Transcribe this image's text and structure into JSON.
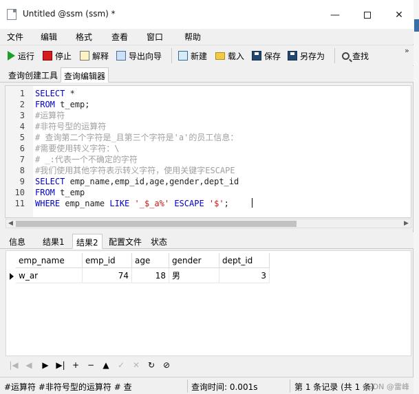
{
  "window": {
    "title": "Untitled @ssm (ssm) *",
    "controls": {
      "minimize": "—",
      "close": "✕"
    }
  },
  "menu": [
    "文件",
    "编辑",
    "格式",
    "查看",
    "窗口",
    "帮助"
  ],
  "toolbar": {
    "run": "运行",
    "stop": "停止",
    "explain": "解释",
    "export_wizard": "导出向导",
    "new": "新建",
    "load": "载入",
    "save": "保存",
    "save_as": "另存为",
    "find": "查找",
    "overflow": "»"
  },
  "editor_tabs": [
    "查询创建工具",
    "查询编辑器"
  ],
  "active_editor_tab": "查询编辑器",
  "editor": {
    "lines": [
      {
        "num": "1",
        "text": "SELECT *",
        "kind": "kw"
      },
      {
        "num": "2",
        "text": "FROM t_emp;",
        "kind": "kw"
      },
      {
        "num": "3",
        "text": "#运算符",
        "kind": "cm"
      },
      {
        "num": "4",
        "text": "#非符号型的运算符",
        "kind": "cm"
      },
      {
        "num": "5",
        "text": "# 查询第二个字符是_且第三个字符是'a'的员工信息：",
        "kind": "cm"
      },
      {
        "num": "6",
        "text": "#需要使用转义字符：\\",
        "kind": "cm"
      },
      {
        "num": "7",
        "text": "# _:代表一个不确定的字符",
        "kind": "cm"
      },
      {
        "num": "8",
        "text": "#我们使用其他字符表示转义字符，使用关键字ESCAPE",
        "kind": "cm"
      },
      {
        "num": "9",
        "text": "SELECT emp_name,emp_id,age,gender,dept_id",
        "kind": "kw"
      },
      {
        "num": "10",
        "text": "FROM t_emp",
        "kind": "kw"
      },
      {
        "num": "11",
        "text": "WHERE emp_name LIKE '_$_a%' ESCAPE '$';",
        "kind": "kw"
      }
    ]
  },
  "result_tabs": [
    "信息",
    "结果1",
    "结果2",
    "配置文件",
    "状态"
  ],
  "active_result_tab": "结果2",
  "grid": {
    "columns": [
      "emp_name",
      "emp_id",
      "age",
      "gender",
      "dept_id"
    ],
    "rows": [
      [
        "w_ar",
        "74",
        "18",
        "男",
        "3"
      ]
    ]
  },
  "navigator": [
    "|◀",
    "◀",
    "▶",
    "▶|",
    "+",
    "−",
    "▲",
    "✓",
    "✕",
    "↻",
    "⊘"
  ],
  "status": {
    "sql_preview": "#运算符 #非符号型的运算符 # 查",
    "query_time": "查询时间: 0.001s",
    "record_info": "第 1 条记录 (共 1 条)",
    "watermark": "CSDN @雷峰"
  }
}
